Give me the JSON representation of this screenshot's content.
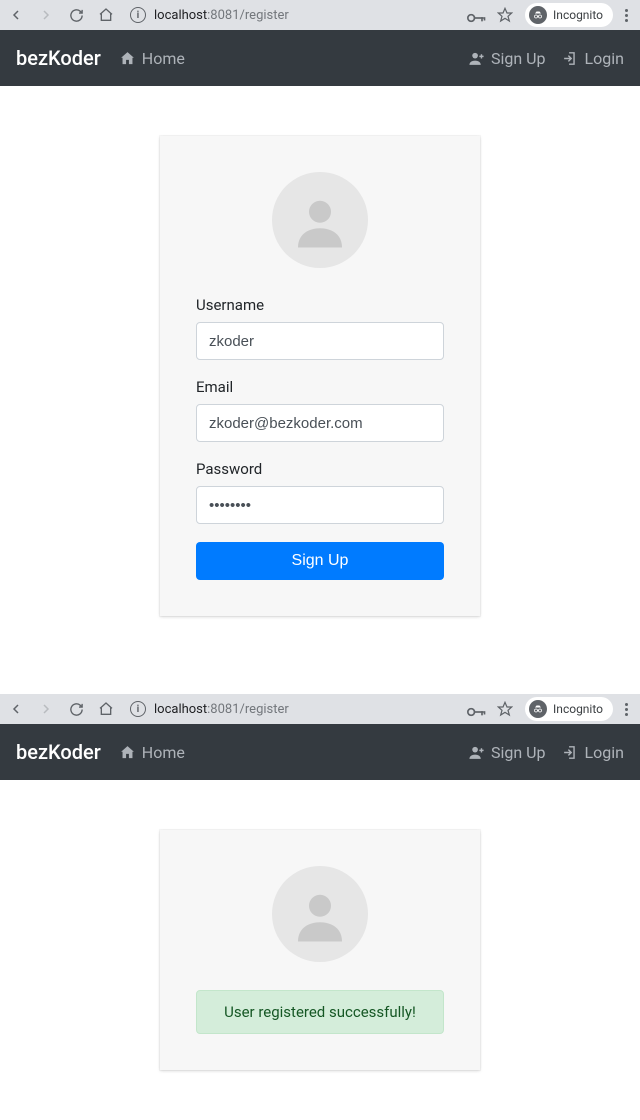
{
  "browser": {
    "url_host": "localhost",
    "url_port": ":8081",
    "url_path": "/register",
    "incognito_label": "Incognito"
  },
  "navbar": {
    "brand": "bezKoder",
    "home": "Home",
    "signup": "Sign Up",
    "login": "Login"
  },
  "form": {
    "username_label": "Username",
    "username_value": "zkoder",
    "email_label": "Email",
    "email_value": "zkoder@bezkoder.com",
    "password_label": "Password",
    "password_value": "••••••••",
    "submit_label": "Sign Up"
  },
  "result": {
    "message": "User registered successfully!"
  },
  "colors": {
    "navbar_bg": "#343a40",
    "primary": "#007bff",
    "success_bg": "#d4edda",
    "success_fg": "#155724"
  }
}
